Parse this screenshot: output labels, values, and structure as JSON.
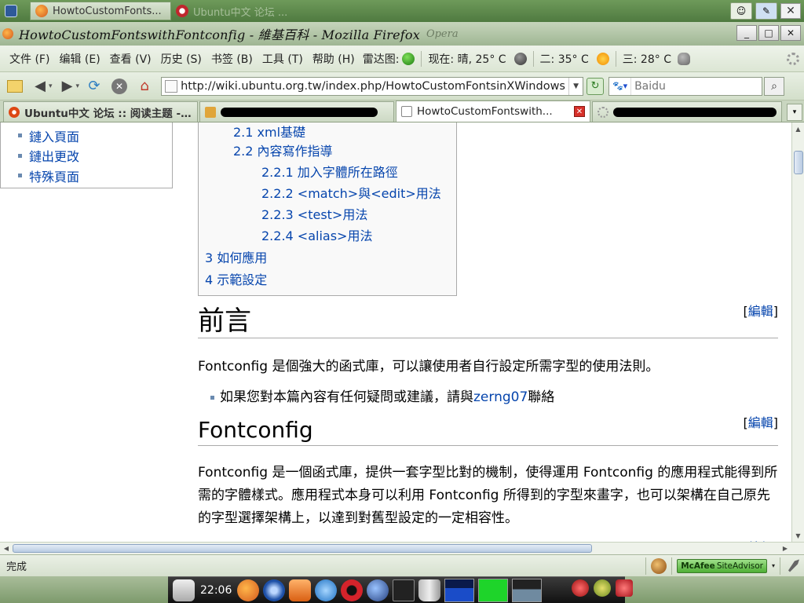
{
  "colors": {
    "link": "#0645ad",
    "title_bar": "#b3c7a6",
    "accent_green": "#4fae35",
    "close_red": "#d7302a"
  },
  "taskbar_top": {
    "task_1": "HowtoCustomFonts...",
    "task_2": "Ubuntu中文 论坛 ..."
  },
  "window": {
    "title": "HowtoCustomFontswithFontconfig - 維基百科 - Mozilla Firefox",
    "title_faded": "Opera",
    "controls": [
      "_",
      "□",
      "✕"
    ]
  },
  "menu": {
    "items": [
      "文件 (F)",
      "编辑 (E)",
      "查看 (V)",
      "历史 (S)",
      "书签 (B)",
      "工具 (T)",
      "帮助 (H)"
    ],
    "radar_label": "雷达图:",
    "weather_now": "现在: 晴, 25° C",
    "weather_day2": "二: 35° C",
    "weather_day3": "三: 28° C"
  },
  "nav": {
    "url": "http://wiki.ubuntu.org.tw/index.php/HowtoCustomFontsinXWindows",
    "search_placeholder": "Baidu",
    "search_engine_icon": "paw-icon"
  },
  "tabs": [
    {
      "label": "Ubuntu中文 论坛 :: 阅读主题 -...",
      "active": false
    },
    {
      "label": "",
      "active": false,
      "redacted": true
    },
    {
      "label": "HowtoCustomFontswith...",
      "active": true
    },
    {
      "label": "",
      "active": false,
      "redacted": true
    }
  ],
  "sidebar": {
    "items": [
      "鏈入頁面",
      "鏈出更改",
      "特殊頁面"
    ]
  },
  "toc": {
    "entries": [
      {
        "label": "2.1 xml基礎",
        "level": 2
      },
      {
        "label": "2.2 內容寫作指導",
        "level": 2
      },
      {
        "label": "2.2.1 加入字體所在路徑",
        "level": 3
      },
      {
        "label": "2.2.2 <match>與<edit>用法",
        "level": 3
      },
      {
        "label": "2.2.3 <test>用法",
        "level": 3
      },
      {
        "label": "2.2.4 <alias>用法",
        "level": 3
      },
      {
        "label": "3 如何應用",
        "level": 1
      },
      {
        "label": "4 示範設定",
        "level": 1
      }
    ]
  },
  "article": {
    "edit_label": "編輯",
    "edit_open": "[",
    "edit_close": "]",
    "section_1_title": "前言",
    "section_1_para": "Fontconfig 是個強大的函式庫，可以讓使用者自行設定所需字型的使用法則。",
    "section_1_bullet_prefix": "如果您對本篇內容有任何疑問或建議，請與",
    "section_1_bullet_link": "zerng07",
    "section_1_bullet_suffix": "聯絡",
    "section_2_title": "Fontconfig",
    "section_2_para": "Fontconfig 是一個函式庫，提供一套字型比對的機制，使得運用 Fontconfig 的應用程式能得到所需的字體樣式。應用程式本身可以利用 Fontconfig 所得到的字型來畫字，也可以架構在自己原先的字型選擇架構上，以達到對舊型設定的一定相容性。"
  },
  "status": {
    "text": "完成",
    "siteadvisor_brand": "McAfee",
    "siteadvisor_product": "SiteAdvisor"
  },
  "dock": {
    "clock": "22:06"
  }
}
